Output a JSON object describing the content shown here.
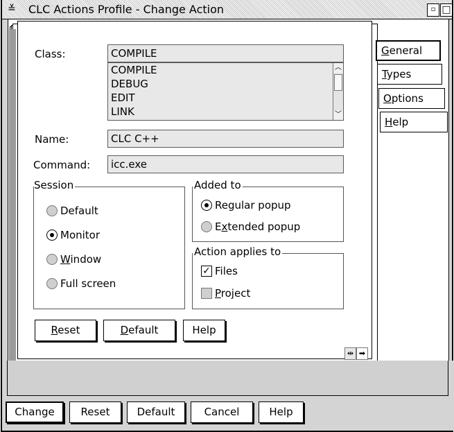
{
  "window": {
    "title": "CLC Actions Profile - Change Action",
    "sysmenu_icon": "≚",
    "minimize_icon": "▫",
    "maximize_icon": "□"
  },
  "tabs": [
    {
      "label_pre": "",
      "label_u": "G",
      "label_post": "eneral"
    },
    {
      "label_pre": "",
      "label_u": "T",
      "label_post": "ypes"
    },
    {
      "label_pre": "",
      "label_u": "O",
      "label_post": "ptions"
    },
    {
      "label_pre": "",
      "label_u": "H",
      "label_post": "elp"
    }
  ],
  "form": {
    "class_label": "Class:",
    "class_value": "COMPILE",
    "class_options": [
      "COMPILE",
      "DEBUG",
      "EDIT",
      "LINK"
    ],
    "name_label": "Name:",
    "name_value": "CLC C++",
    "command_label": "Command:",
    "command_value": "icc.exe"
  },
  "session": {
    "title": "Session",
    "options": [
      {
        "pre": "",
        "u": "",
        "post": "Default",
        "selected": false
      },
      {
        "pre": "",
        "u": "",
        "post": "Monitor",
        "selected": true
      },
      {
        "pre": "",
        "u": "W",
        "post": "indow",
        "selected": false
      },
      {
        "pre": "",
        "u": "",
        "post": "Full screen",
        "selected": false
      }
    ]
  },
  "added_to": {
    "title": "Added to",
    "options": [
      {
        "pre": "",
        "u": "",
        "post": "Regular popup",
        "selected": true
      },
      {
        "pre": "E",
        "u": "x",
        "post": "tended popup",
        "selected": false
      }
    ]
  },
  "applies_to": {
    "title": "Action applies to",
    "options": [
      {
        "pre": "",
        "u": "",
        "post": "Files",
        "checked": true
      },
      {
        "pre": "",
        "u": "P",
        "post": "roject",
        "checked": false
      }
    ]
  },
  "page_buttons": {
    "reset": {
      "u": "R",
      "post": "eset"
    },
    "default": {
      "u": "D",
      "post": "efault"
    },
    "help": "Help"
  },
  "dialog_buttons": {
    "change": "Change",
    "reset": "Reset",
    "default": "Default",
    "cancel": "Cancel",
    "help": "Help"
  },
  "page_nav": {
    "prev_icon": "⇹",
    "next_icon": "➡"
  }
}
